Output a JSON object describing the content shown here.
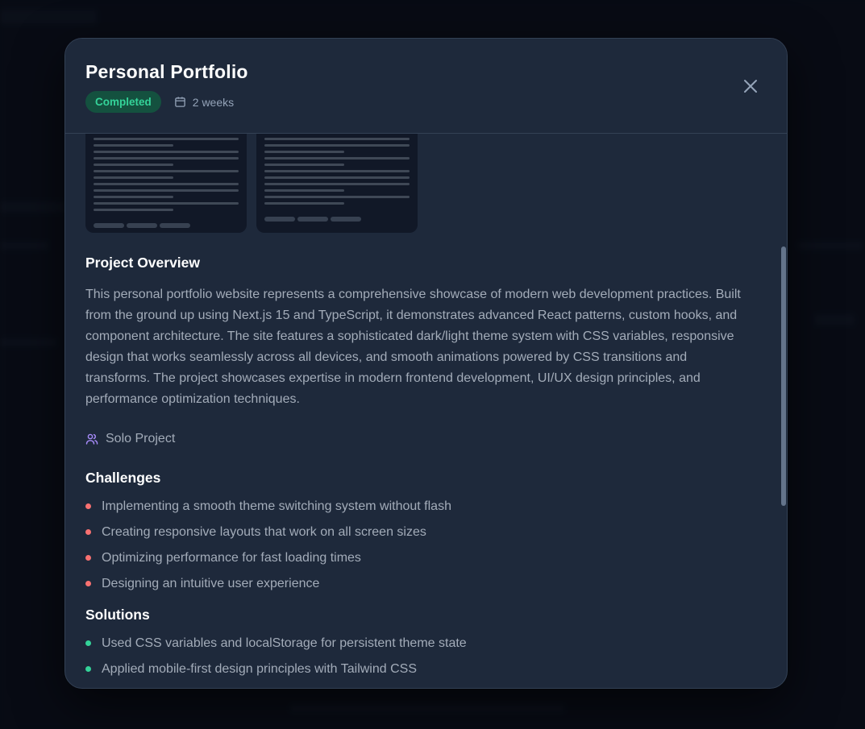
{
  "modal": {
    "title": "Personal Portfolio",
    "status": "Completed",
    "duration": "2 weeks",
    "close_icon": "close-icon",
    "calendar_icon": "calendar-icon"
  },
  "overview": {
    "heading": "Project Overview",
    "text": "This personal portfolio website represents a comprehensive showcase of modern web development practices. Built from the ground up using Next.js 15 and TypeScript, it demonstrates advanced React patterns, custom hooks, and component architecture. The site features a sophisticated dark/light theme system with CSS variables, responsive design that works seamlessly across all devices, and smooth animations powered by CSS transitions and transforms. The project showcases expertise in modern frontend development, UI/UX design principles, and performance optimization techniques."
  },
  "team": {
    "icon": "users-icon",
    "label": "Solo Project"
  },
  "challenges": {
    "heading": "Challenges",
    "items": [
      "Implementing a smooth theme switching system without flash",
      "Creating responsive layouts that work on all screen sizes",
      "Optimizing performance for fast loading times",
      "Designing an intuitive user experience"
    ]
  },
  "solutions": {
    "heading": "Solutions",
    "items": [
      "Used CSS variables and localStorage for persistent theme state",
      "Applied mobile-first design principles with Tailwind CSS"
    ]
  },
  "colors": {
    "modal_bg": "#1e293b",
    "badge_bg": "#14513f",
    "badge_text": "#34d399",
    "challenge_dot": "#f87171",
    "solution_dot": "#34d399",
    "team_icon": "#a78bfa"
  }
}
